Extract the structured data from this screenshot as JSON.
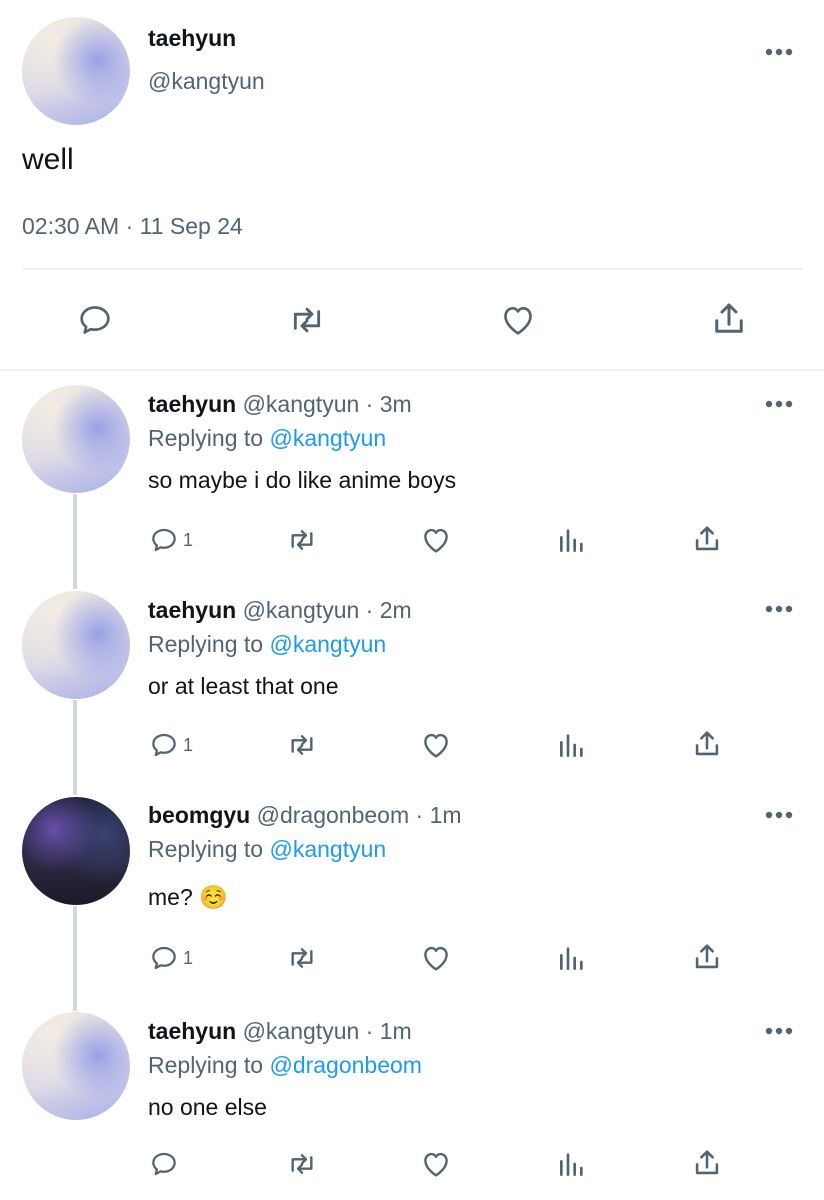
{
  "main_tweet": {
    "display_name": "taehyun",
    "handle": "@kangtyun",
    "text": "well",
    "timestamp": "02:30 AM · 11 Sep 24"
  },
  "replies": [
    {
      "display_name": "taehyun",
      "handle_time": "@kangtyun · 3m",
      "replying_prefix": "Replying to",
      "replying_to": "@kangtyun",
      "text": "so maybe i do like anime boys",
      "reply_count": "1"
    },
    {
      "display_name": "taehyun",
      "handle_time": "@kangtyun · 2m",
      "replying_prefix": "Replying to",
      "replying_to": "@kangtyun",
      "text": "or at least that one",
      "reply_count": "1"
    },
    {
      "display_name": "beomgyu",
      "handle_time": "@dragonbeom · 1m",
      "replying_prefix": "Replying to",
      "replying_to": "@kangtyun",
      "text": "me? ☺️",
      "reply_count": "1"
    },
    {
      "display_name": "taehyun",
      "handle_time": "@kangtyun · 1m",
      "replying_prefix": "Replying to",
      "replying_to": "@dragonbeom",
      "text": "no one else",
      "reply_count": ""
    }
  ],
  "icons": {
    "reply": "speech-bubble-icon",
    "retweet": "retweet-icon",
    "like": "heart-icon",
    "views": "bar-chart-icon",
    "share": "share-upload-icon",
    "more": "more-dots-icon"
  },
  "colors": {
    "link": "#1d9bf0",
    "muted": "#536471",
    "text": "#0f1419"
  }
}
